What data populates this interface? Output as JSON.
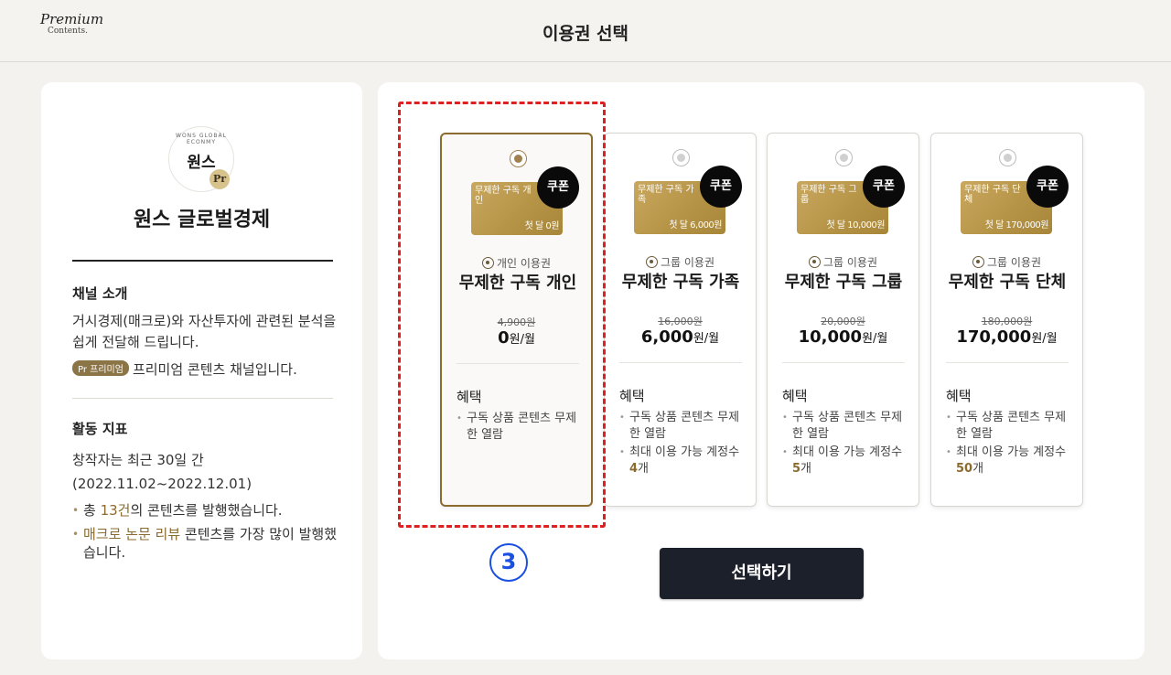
{
  "header": {
    "logo_line1": "Premium",
    "logo_line2": "Contents.",
    "title": "이용권 선택"
  },
  "channel": {
    "logo_arc": "WONS GLOBAL ECONMY",
    "logo_text": "원스",
    "logo_badge": "Pr",
    "name": "원스 글로벌경제",
    "intro_title": "채널 소개",
    "intro_desc": "거시경제(매크로)와 자산투자에 관련된 분석을 쉽게 전달해 드립니다.",
    "premium_badge": "Pr 프리미엄",
    "premium_text": "프리미엄 콘텐츠 채널입니다.",
    "activity_title": "활동 지표",
    "activity_line1": "창작자는 최근 30일 간",
    "activity_period": "(2022.11.02~2022.12.01)",
    "stats": [
      {
        "pre": "총 ",
        "hl": "13건",
        "post": "의 콘텐츠를 발행했습니다."
      },
      {
        "pre": "",
        "hl": "매크로 논문 리뷰",
        "post": " 콘텐츠를 가장 많이 발행했습니다."
      }
    ]
  },
  "plans": [
    {
      "selected": true,
      "ticket_name": "무제한 구독 개인",
      "ticket_price": "첫 달 0원",
      "coupon": "쿠폰",
      "type": "개인 이용권",
      "name": "무제한 구독 개인",
      "orig_price": "4,900원",
      "price": "0",
      "price_unit": "원/월",
      "benefit_title": "혜택",
      "benefits": [
        {
          "text": "구독 상품 콘텐츠 무제한 열람"
        }
      ]
    },
    {
      "selected": false,
      "ticket_name": "무제한 구독 가족",
      "ticket_price": "첫 달 6,000원",
      "coupon": "쿠폰",
      "type": "그룹 이용권",
      "name": "무제한 구독 가족",
      "orig_price": "16,000원",
      "price": "6,000",
      "price_unit": "원/월",
      "benefit_title": "혜택",
      "benefits": [
        {
          "text": "구독 상품 콘텐츠 무제한 열람"
        },
        {
          "text": "최대 이용 가능 계정수 ",
          "num": "4",
          "suffix": "개"
        }
      ]
    },
    {
      "selected": false,
      "ticket_name": "무제한 구독 그룹",
      "ticket_price": "첫 달 10,000원",
      "coupon": "쿠폰",
      "type": "그룹 이용권",
      "name": "무제한 구독 그룹",
      "orig_price": "20,000원",
      "price": "10,000",
      "price_unit": "원/월",
      "benefit_title": "혜택",
      "benefits": [
        {
          "text": "구독 상품 콘텐츠 무제한 열람"
        },
        {
          "text": "최대 이용 가능 계정수 ",
          "num": "5",
          "suffix": "개"
        }
      ]
    },
    {
      "selected": false,
      "ticket_name": "무제한 구독 단체",
      "ticket_price": "첫 달 170,000원",
      "coupon": "쿠폰",
      "type": "그룹 이용권",
      "name": "무제한 구독 단체",
      "orig_price": "180,000원",
      "price": "170,000",
      "price_unit": "원/월",
      "benefit_title": "혜택",
      "benefits": [
        {
          "text": "구독 상품 콘텐츠 무제한 열람"
        },
        {
          "text": "최대 이용 가능 계정수 ",
          "num": "50",
          "suffix": "개"
        }
      ]
    }
  ],
  "annotation": {
    "step": "3",
    "color": "#e02020",
    "marker_color": "#1a4fe0"
  },
  "actions": {
    "select_label": "선택하기"
  }
}
